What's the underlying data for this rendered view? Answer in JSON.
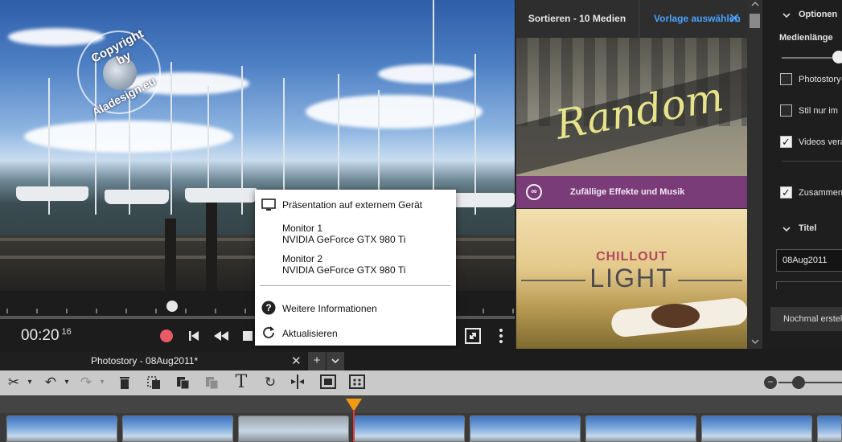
{
  "preview": {
    "watermark_top": "Copyright by",
    "watermark_bottom": "Aladesign.eu"
  },
  "transport": {
    "timecode": "00:20",
    "timecode_frames": "16",
    "scrub_progress": 0.33
  },
  "popup": {
    "title": "Präsentation auf externem Gerät",
    "monitor1_name": "Monitor 1",
    "monitor1_gpu": "NVIDIA GeForce GTX 980 Ti",
    "monitor2_name": "Monitor 2",
    "monitor2_gpu": "NVIDIA GeForce GTX 980 Ti",
    "more_info": "Weitere Informationen",
    "refresh": "Aktualisieren"
  },
  "templates": {
    "sort_label": "Sortieren - 10 Medien",
    "choose_label": "Vorlage auswählen",
    "card1_title": "Random",
    "card1_caption": "Zufällige Effekte und Musik",
    "card2_subtitle": "CHILLOUT",
    "card2_title": "LIGHT"
  },
  "options": {
    "header": "Optionen",
    "media_length": "Medienlänge",
    "cb1": "Photostory-",
    "cb2": "Stil nur im",
    "cb3": "Videos vera",
    "cb4": "Zusammen",
    "title_header": "Titel",
    "title_value": "08Aug2011",
    "regen_button": "Nochmal erstel"
  },
  "timeline": {
    "tab_title": "Photostory - 08Aug2011*",
    "plus": "+",
    "zoom_level": 0.25
  },
  "colors": {
    "accent": "#4aa3ff",
    "random_band": "#7a3b79",
    "playhead": "#f29b12",
    "record": "#e95a69"
  }
}
